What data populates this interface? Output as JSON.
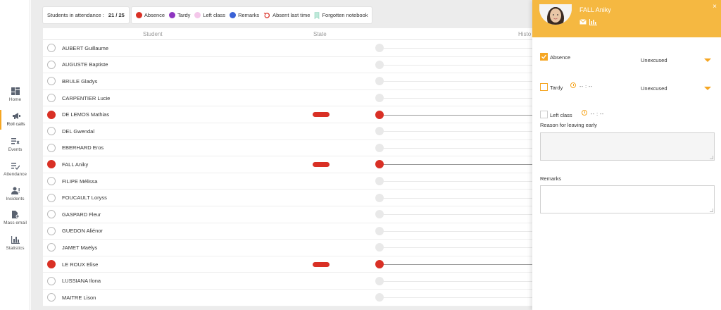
{
  "sidebar": {
    "items": [
      {
        "label": "Home",
        "icon": "dashboard-icon"
      },
      {
        "label": "Roll calls",
        "icon": "megaphone-icon"
      },
      {
        "label": "Events",
        "icon": "events-list-icon"
      },
      {
        "label": "Attendance",
        "icon": "attendance-check-icon"
      },
      {
        "label": "Incidents",
        "icon": "person-alert-icon"
      },
      {
        "label": "Mass email",
        "icon": "document-add-icon"
      },
      {
        "label": "Statistics",
        "icon": "bar-chart-icon"
      }
    ]
  },
  "attendance": {
    "label": "Students in attendance :",
    "count": "21 / 25"
  },
  "legend": {
    "absence": "Absence",
    "tardy": "Tardy",
    "left_class": "Left class",
    "remarks": "Remarks",
    "absent_last_time": "Absent last time",
    "forgotten_notebook": "Forgotten notebook"
  },
  "colors": {
    "absence": "#d93025",
    "tardy": "#8e35c0",
    "left_class": "#f4c7ea",
    "remarks": "#3a62d6",
    "accent": "#f5a623",
    "panel_header": "#f5b841"
  },
  "table": {
    "headers": {
      "student": "Student",
      "state": "State",
      "history": "Histo"
    },
    "rows": [
      {
        "name": "AUBERT Guillaume",
        "absent": false
      },
      {
        "name": "AUGUSTE Baptiste",
        "absent": false
      },
      {
        "name": "BRULE Gladys",
        "absent": false
      },
      {
        "name": "CARPENTIER Lucie",
        "absent": false
      },
      {
        "name": "DE LEMOS Mathias",
        "absent": true
      },
      {
        "name": "DEL Gwendal",
        "absent": false
      },
      {
        "name": "EBERHARD Eros",
        "absent": false
      },
      {
        "name": "FALL Aniky",
        "absent": true
      },
      {
        "name": "FILIPE Mélissa",
        "absent": false
      },
      {
        "name": "FOUCAULT Loryss",
        "absent": false
      },
      {
        "name": "GASPARD Fleur",
        "absent": false
      },
      {
        "name": "GUEDON Aliénor",
        "absent": false
      },
      {
        "name": "JAMET Maëlys",
        "absent": false
      },
      {
        "name": "LE ROUX Elise",
        "absent": true
      },
      {
        "name": "LUSSIANA Ilona",
        "absent": false
      },
      {
        "name": "MAITRE Lison",
        "absent": false
      }
    ]
  },
  "panel": {
    "student_name": "FALL Aniky",
    "absence_label": "Absence",
    "absence_value": "Unexcused",
    "tardy_label": "Tardy",
    "tardy_time": "-- : --",
    "tardy_value": "Unexcused",
    "left_label": "Left class",
    "left_time": "-- : --",
    "reason_label": "Reason for leaving early",
    "remarks_label": "Remarks",
    "close": "×"
  }
}
